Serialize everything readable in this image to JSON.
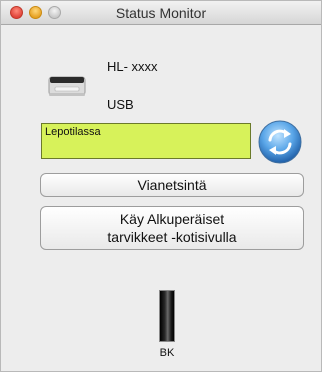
{
  "window": {
    "title": "Status Monitor"
  },
  "device": {
    "model": "HL- xxxx",
    "connection": "USB"
  },
  "status": {
    "text": "Lepotilassa",
    "color": "#d7f25a"
  },
  "buttons": {
    "troubleshoot": "Vianetsintä",
    "supplies_line1": "Käy Alkuperäiset",
    "supplies_line2": "tarvikkeet -kotisivulla"
  },
  "ink": {
    "label": "BK"
  },
  "icons": {
    "printer": "printer-icon",
    "refresh": "refresh-icon"
  }
}
